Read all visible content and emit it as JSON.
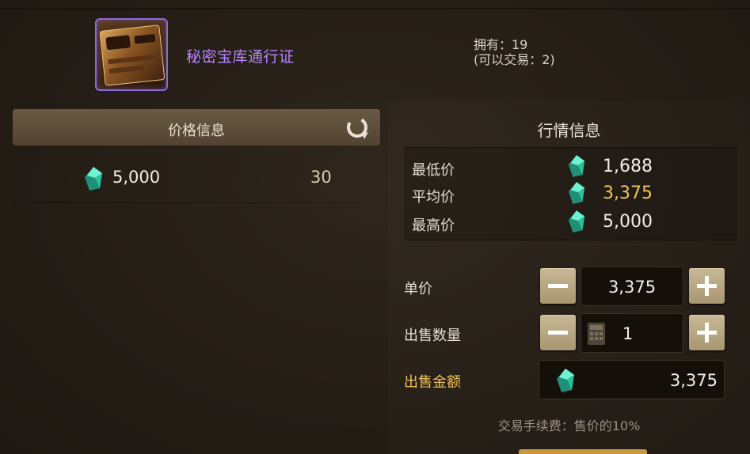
{
  "item": {
    "name": "秘密宝库通行证",
    "owned_text": "拥有：19",
    "tradable_text": "(可以交易：2)"
  },
  "price_info": {
    "title": "价格信息",
    "refresh_icon": "refresh-icon",
    "rows": [
      {
        "price": "5,000",
        "quantity": "30"
      }
    ]
  },
  "market_info": {
    "title": "行情信息",
    "rows": [
      {
        "label": "最低价",
        "value": "1,688"
      },
      {
        "label": "平均价",
        "value": "3,375"
      },
      {
        "label": "最高价",
        "value": "5,000"
      }
    ]
  },
  "sell_form": {
    "unit_price_label": "单价",
    "unit_price_value": "3,375",
    "quantity_label": "出售数量",
    "quantity_value": "1",
    "total_label": "出售金额",
    "total_value": "3,375",
    "fee_text": "交易手续费：售价的10%"
  },
  "colors": {
    "item_name": "#b786ff",
    "highlight": "#f2c25a",
    "gem": "#3fd9b0",
    "button": "#b9a882"
  }
}
